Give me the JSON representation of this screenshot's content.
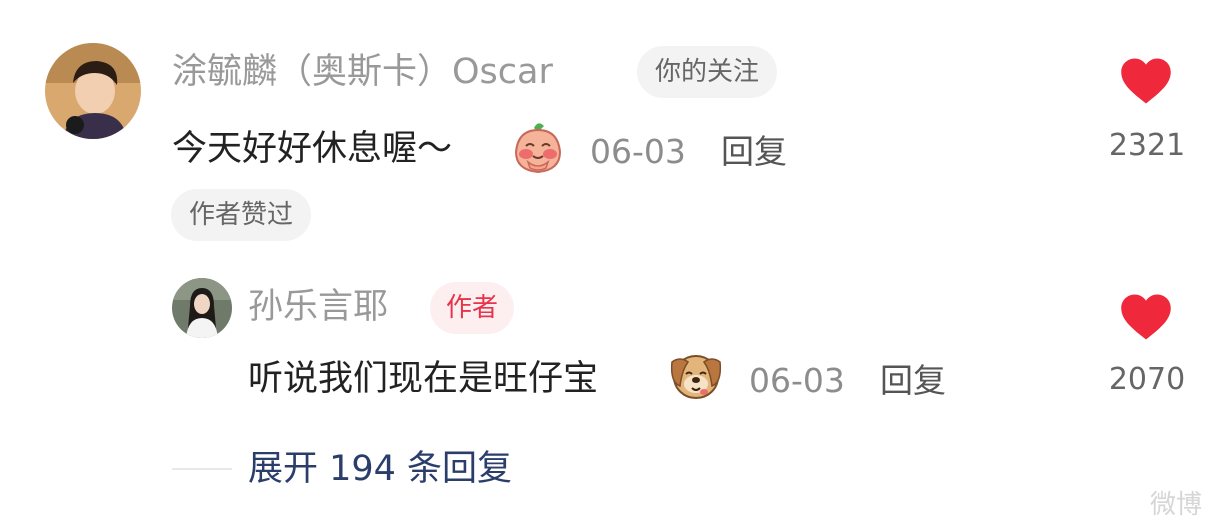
{
  "comment": {
    "username": "涂毓麟（奥斯卡）Oscar",
    "follow_badge": "你的关注",
    "text": "今天好好休息喔～",
    "emoji": "peach-sticker",
    "date": "06-03",
    "reply_label": "回复",
    "liked_by_author": "作者赞过",
    "like_count": "2321",
    "like_color": "#f0283c"
  },
  "reply": {
    "username": "孙乐言耶",
    "author_badge": "作者",
    "text": "听说我们现在是旺仔宝",
    "emoji": "puppy-sticker",
    "date": "06-03",
    "reply_label": "回复",
    "like_count": "2070",
    "like_color": "#f0283c"
  },
  "expand": {
    "label": "展开 194 条回复"
  },
  "watermark": "微博"
}
